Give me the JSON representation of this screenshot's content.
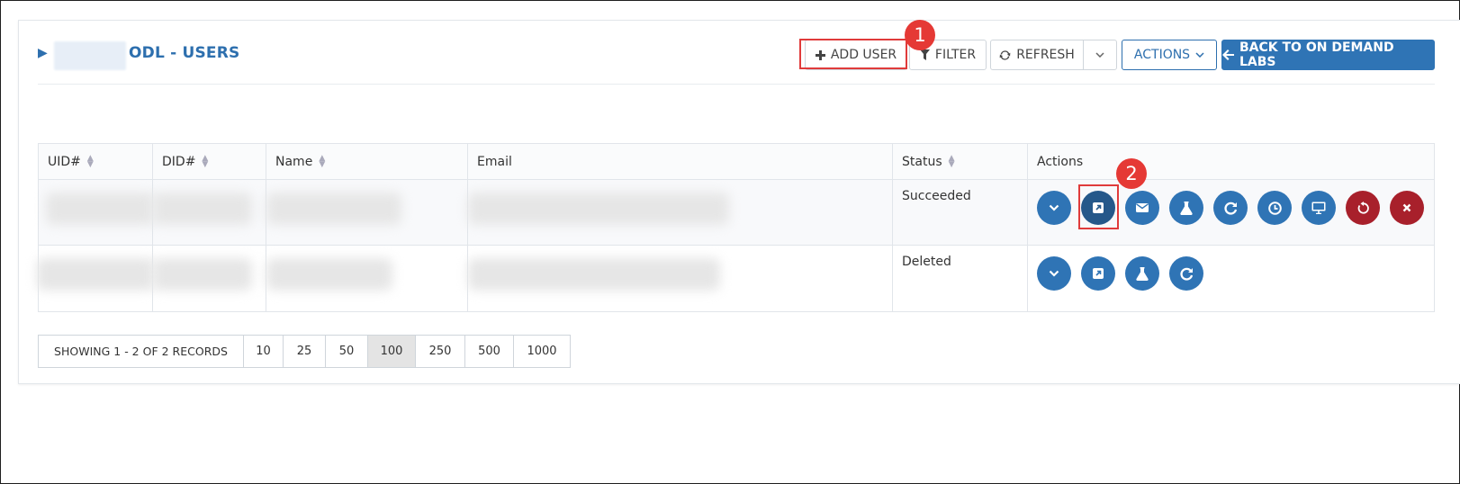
{
  "header": {
    "title": "ODL - USERS"
  },
  "toolbar": {
    "add_user": "ADD USER",
    "filter": "FILTER",
    "refresh": "REFRESH",
    "actions": "ACTIONS",
    "back": "BACK TO ON DEMAND LABS"
  },
  "callouts": [
    "1",
    "2"
  ],
  "table": {
    "columns": [
      "UID#",
      "DID#",
      "Name",
      "Email",
      "Status",
      "Actions"
    ],
    "rows": [
      {
        "status": "Succeeded",
        "actions": [
          "expand-icon",
          "external-link-icon",
          "email-icon",
          "flask-icon",
          "refresh-icon",
          "clock-icon",
          "monitor-icon",
          "reset-icon",
          "delete-icon"
        ]
      },
      {
        "status": "Deleted",
        "actions": [
          "expand-icon",
          "external-link-icon",
          "flask-icon",
          "refresh-icon"
        ]
      }
    ]
  },
  "pagination": {
    "info": "SHOWING 1 - 2 OF 2 RECORDS",
    "sizes": [
      "10",
      "25",
      "50",
      "100",
      "250",
      "500",
      "1000"
    ],
    "selected": "100"
  },
  "colors": {
    "primary": "#2f74b5",
    "danger": "#a8202b",
    "highlight": "#e03b3b"
  }
}
